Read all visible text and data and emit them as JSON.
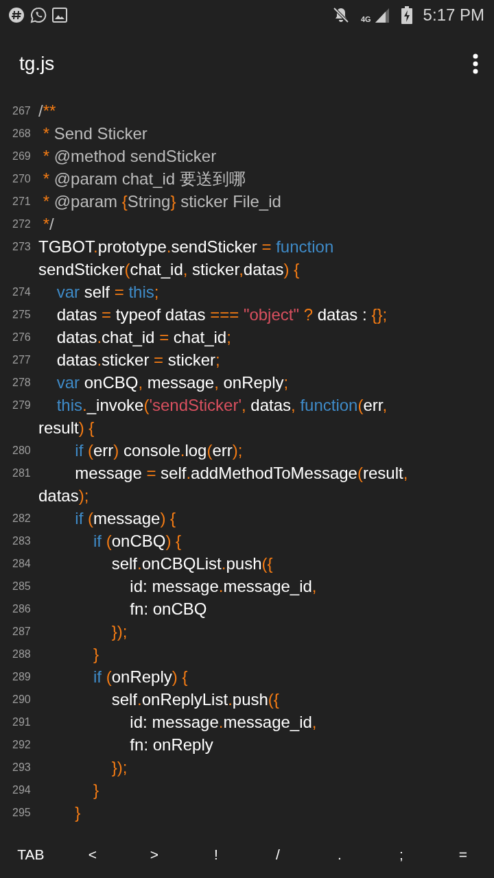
{
  "status_bar": {
    "network": "4G",
    "time": "5:17 PM"
  },
  "app_bar": {
    "title": "tg.js"
  },
  "lines": [
    {
      "number": "267",
      "rows": [
        {
          "tokens": [
            {
              "kind": "comment",
              "text": "/"
            },
            {
              "kind": "punct",
              "text": "**"
            }
          ]
        }
      ]
    },
    {
      "number": "268",
      "rows": [
        {
          "tokens": [
            {
              "kind": "punct",
              "text": " *"
            },
            {
              "kind": "comment",
              "text": " Send Sticker"
            }
          ]
        }
      ]
    },
    {
      "number": "269",
      "rows": [
        {
          "tokens": [
            {
              "kind": "punct",
              "text": " *"
            },
            {
              "kind": "comment",
              "text": " @method sendSticker"
            }
          ]
        }
      ]
    },
    {
      "number": "270",
      "rows": [
        {
          "tokens": [
            {
              "kind": "punct",
              "text": " *"
            },
            {
              "kind": "comment",
              "text": " @param chat_id 要送到哪"
            }
          ]
        }
      ]
    },
    {
      "number": "271",
      "rows": [
        {
          "tokens": [
            {
              "kind": "punct",
              "text": " *"
            },
            {
              "kind": "comment",
              "text": " @param "
            },
            {
              "kind": "punct",
              "text": "{"
            },
            {
              "kind": "comment",
              "text": "String"
            },
            {
              "kind": "punct",
              "text": "}"
            },
            {
              "kind": "comment",
              "text": " sticker File_id"
            }
          ]
        }
      ]
    },
    {
      "number": "272",
      "rows": [
        {
          "tokens": [
            {
              "kind": "punct",
              "text": " *"
            },
            {
              "kind": "comment",
              "text": "/"
            }
          ]
        }
      ]
    },
    {
      "number": "273",
      "rows": [
        {
          "tokens": [
            {
              "kind": "plain",
              "text": "TGBOT"
            },
            {
              "kind": "punct",
              "text": "."
            },
            {
              "kind": "plain",
              "text": "prototype"
            },
            {
              "kind": "punct",
              "text": "."
            },
            {
              "kind": "plain",
              "text": "sendSticker "
            },
            {
              "kind": "punct",
              "text": "="
            },
            {
              "kind": "keyword",
              "text": " function"
            }
          ]
        },
        {
          "tokens": [
            {
              "kind": "plain",
              "text": "sendSticker"
            },
            {
              "kind": "punct",
              "text": "("
            },
            {
              "kind": "plain",
              "text": "chat_id"
            },
            {
              "kind": "punct",
              "text": ","
            },
            {
              "kind": "plain",
              "text": " sticker"
            },
            {
              "kind": "punct",
              "text": ","
            },
            {
              "kind": "plain",
              "text": "datas"
            },
            {
              "kind": "punct",
              "text": ")"
            },
            {
              "kind": "punct",
              "text": " {"
            }
          ]
        }
      ]
    },
    {
      "number": "274",
      "rows": [
        {
          "tokens": [
            {
              "kind": "keyword",
              "text": "    var"
            },
            {
              "kind": "plain",
              "text": " self "
            },
            {
              "kind": "punct",
              "text": "="
            },
            {
              "kind": "keyword",
              "text": " this"
            },
            {
              "kind": "punct",
              "text": ";"
            }
          ]
        }
      ]
    },
    {
      "number": "275",
      "rows": [
        {
          "tokens": [
            {
              "kind": "plain",
              "text": "    datas "
            },
            {
              "kind": "punct",
              "text": "="
            },
            {
              "kind": "plain",
              "text": " typeof datas "
            },
            {
              "kind": "punct",
              "text": "==="
            },
            {
              "kind": "string",
              "text": " \"object\""
            },
            {
              "kind": "punct",
              "text": " ?"
            },
            {
              "kind": "plain",
              "text": " datas : "
            },
            {
              "kind": "punct",
              "text": "{};"
            }
          ]
        }
      ]
    },
    {
      "number": "276",
      "rows": [
        {
          "tokens": [
            {
              "kind": "plain",
              "text": "    datas"
            },
            {
              "kind": "punct",
              "text": "."
            },
            {
              "kind": "plain",
              "text": "chat_id "
            },
            {
              "kind": "punct",
              "text": "="
            },
            {
              "kind": "plain",
              "text": " chat_id"
            },
            {
              "kind": "punct",
              "text": ";"
            }
          ]
        }
      ]
    },
    {
      "number": "277",
      "rows": [
        {
          "tokens": [
            {
              "kind": "plain",
              "text": "    datas"
            },
            {
              "kind": "punct",
              "text": "."
            },
            {
              "kind": "plain",
              "text": "sticker "
            },
            {
              "kind": "punct",
              "text": "="
            },
            {
              "kind": "plain",
              "text": " sticker"
            },
            {
              "kind": "punct",
              "text": ";"
            }
          ]
        }
      ]
    },
    {
      "number": "278",
      "rows": [
        {
          "tokens": [
            {
              "kind": "keyword",
              "text": "    var"
            },
            {
              "kind": "plain",
              "text": " onCBQ"
            },
            {
              "kind": "punct",
              "text": ","
            },
            {
              "kind": "plain",
              "text": " message"
            },
            {
              "kind": "punct",
              "text": ","
            },
            {
              "kind": "plain",
              "text": " onReply"
            },
            {
              "kind": "punct",
              "text": ";"
            }
          ]
        }
      ]
    },
    {
      "number": "279",
      "rows": [
        {
          "tokens": [
            {
              "kind": "keyword",
              "text": "    this"
            },
            {
              "kind": "punct",
              "text": "."
            },
            {
              "kind": "plain",
              "text": "_invoke"
            },
            {
              "kind": "punct",
              "text": "("
            },
            {
              "kind": "string",
              "text": "'sendSticker'"
            },
            {
              "kind": "punct",
              "text": ","
            },
            {
              "kind": "plain",
              "text": " datas"
            },
            {
              "kind": "punct",
              "text": ","
            },
            {
              "kind": "keyword",
              "text": " function"
            },
            {
              "kind": "punct",
              "text": "("
            },
            {
              "kind": "plain",
              "text": "err"
            },
            {
              "kind": "punct",
              "text": ","
            }
          ]
        },
        {
          "tokens": [
            {
              "kind": "plain",
              "text": "result"
            },
            {
              "kind": "punct",
              "text": ")"
            },
            {
              "kind": "punct",
              "text": " {"
            }
          ]
        }
      ]
    },
    {
      "number": "280",
      "rows": [
        {
          "tokens": [
            {
              "kind": "keyword",
              "text": "        if"
            },
            {
              "kind": "punct",
              "text": " ("
            },
            {
              "kind": "plain",
              "text": "err"
            },
            {
              "kind": "punct",
              "text": ")"
            },
            {
              "kind": "plain",
              "text": " console"
            },
            {
              "kind": "punct",
              "text": "."
            },
            {
              "kind": "plain",
              "text": "log"
            },
            {
              "kind": "punct",
              "text": "("
            },
            {
              "kind": "plain",
              "text": "err"
            },
            {
              "kind": "punct",
              "text": ");"
            }
          ]
        }
      ]
    },
    {
      "number": "281",
      "rows": [
        {
          "tokens": [
            {
              "kind": "plain",
              "text": "        message "
            },
            {
              "kind": "punct",
              "text": "="
            },
            {
              "kind": "plain",
              "text": " self"
            },
            {
              "kind": "punct",
              "text": "."
            },
            {
              "kind": "plain",
              "text": "addMethodToMessage"
            },
            {
              "kind": "punct",
              "text": "("
            },
            {
              "kind": "plain",
              "text": "result"
            },
            {
              "kind": "punct",
              "text": ","
            }
          ]
        },
        {
          "tokens": [
            {
              "kind": "plain",
              "text": "datas"
            },
            {
              "kind": "punct",
              "text": ");"
            }
          ]
        }
      ]
    },
    {
      "number": "282",
      "rows": [
        {
          "tokens": [
            {
              "kind": "keyword",
              "text": "        if"
            },
            {
              "kind": "punct",
              "text": " ("
            },
            {
              "kind": "plain",
              "text": "message"
            },
            {
              "kind": "punct",
              "text": ")"
            },
            {
              "kind": "punct",
              "text": " {"
            }
          ]
        }
      ]
    },
    {
      "number": "283",
      "rows": [
        {
          "tokens": [
            {
              "kind": "keyword",
              "text": "            if"
            },
            {
              "kind": "punct",
              "text": " ("
            },
            {
              "kind": "plain",
              "text": "onCBQ"
            },
            {
              "kind": "punct",
              "text": ")"
            },
            {
              "kind": "punct",
              "text": " {"
            }
          ]
        }
      ]
    },
    {
      "number": "284",
      "rows": [
        {
          "tokens": [
            {
              "kind": "plain",
              "text": "                self"
            },
            {
              "kind": "punct",
              "text": "."
            },
            {
              "kind": "plain",
              "text": "onCBQList"
            },
            {
              "kind": "punct",
              "text": "."
            },
            {
              "kind": "plain",
              "text": "push"
            },
            {
              "kind": "punct",
              "text": "({"
            }
          ]
        }
      ]
    },
    {
      "number": "285",
      "rows": [
        {
          "tokens": [
            {
              "kind": "plain",
              "text": "                    id: message"
            },
            {
              "kind": "punct",
              "text": "."
            },
            {
              "kind": "plain",
              "text": "message_id"
            },
            {
              "kind": "punct",
              "text": ","
            }
          ]
        }
      ]
    },
    {
      "number": "286",
      "rows": [
        {
          "tokens": [
            {
              "kind": "plain",
              "text": "                    fn: onCBQ"
            }
          ]
        }
      ]
    },
    {
      "number": "287",
      "rows": [
        {
          "tokens": [
            {
              "kind": "punct",
              "text": "                });"
            }
          ]
        }
      ]
    },
    {
      "number": "288",
      "rows": [
        {
          "tokens": [
            {
              "kind": "punct",
              "text": "            }"
            }
          ]
        }
      ]
    },
    {
      "number": "289",
      "rows": [
        {
          "tokens": [
            {
              "kind": "keyword",
              "text": "            if"
            },
            {
              "kind": "punct",
              "text": " ("
            },
            {
              "kind": "plain",
              "text": "onReply"
            },
            {
              "kind": "punct",
              "text": ")"
            },
            {
              "kind": "punct",
              "text": " {"
            }
          ]
        }
      ]
    },
    {
      "number": "290",
      "rows": [
        {
          "tokens": [
            {
              "kind": "plain",
              "text": "                self"
            },
            {
              "kind": "punct",
              "text": "."
            },
            {
              "kind": "plain",
              "text": "onReplyList"
            },
            {
              "kind": "punct",
              "text": "."
            },
            {
              "kind": "plain",
              "text": "push"
            },
            {
              "kind": "punct",
              "text": "({"
            }
          ]
        }
      ]
    },
    {
      "number": "291",
      "rows": [
        {
          "tokens": [
            {
              "kind": "plain",
              "text": "                    id: message"
            },
            {
              "kind": "punct",
              "text": "."
            },
            {
              "kind": "plain",
              "text": "message_id"
            },
            {
              "kind": "punct",
              "text": ","
            }
          ]
        }
      ]
    },
    {
      "number": "292",
      "rows": [
        {
          "tokens": [
            {
              "kind": "plain",
              "text": "                    fn: onReply"
            }
          ]
        }
      ]
    },
    {
      "number": "293",
      "rows": [
        {
          "tokens": [
            {
              "kind": "punct",
              "text": "                });"
            }
          ]
        }
      ]
    },
    {
      "number": "294",
      "rows": [
        {
          "tokens": [
            {
              "kind": "punct",
              "text": "            }"
            }
          ]
        }
      ]
    },
    {
      "number": "295",
      "rows": [
        {
          "tokens": [
            {
              "kind": "punct",
              "text": "        }"
            }
          ]
        }
      ]
    }
  ],
  "keys": [
    "TAB",
    "<",
    ">",
    "!",
    "/",
    ".",
    ";",
    "="
  ]
}
